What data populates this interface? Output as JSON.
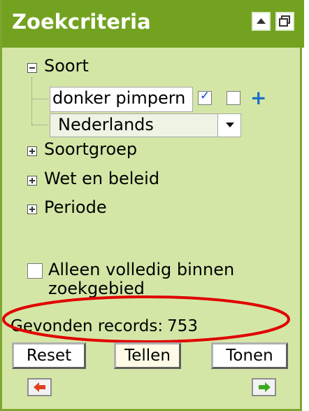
{
  "panel": {
    "title": "Zoekcriteria",
    "header_buttons": [
      {
        "icon": "collapse-up-icon"
      },
      {
        "icon": "restore-window-icon"
      }
    ]
  },
  "tree": {
    "soort": {
      "label": "Soort",
      "expanded": true,
      "input_value": "donker pimpern",
      "checkbox1_checked": true,
      "checkbox2_checked": false,
      "add_icon": "plus-add-icon",
      "language_select": {
        "selected": "Nederlands"
      }
    },
    "soortgroep": {
      "label": "Soortgroep",
      "expanded": false
    },
    "wet_beleid": {
      "label": "Wet en beleid",
      "expanded": false
    },
    "periode": {
      "label": "Periode",
      "expanded": false
    }
  },
  "options": {
    "only_full_label": "Alleen volledig binnen zoekgebied",
    "only_full_checked": false
  },
  "results": {
    "label": "Gevonden records:",
    "count": "753"
  },
  "buttons": {
    "reset": "Reset",
    "tellen": "Tellen",
    "tonen": "Tonen"
  },
  "navigation": {
    "prev_icon": "red-arrow-left-icon",
    "next_icon": "green-arrow-right-icon"
  },
  "colors": {
    "header": "#72a21f",
    "panel_bg": "#d4e6a6",
    "highlight_ellipse": "#e00000"
  }
}
